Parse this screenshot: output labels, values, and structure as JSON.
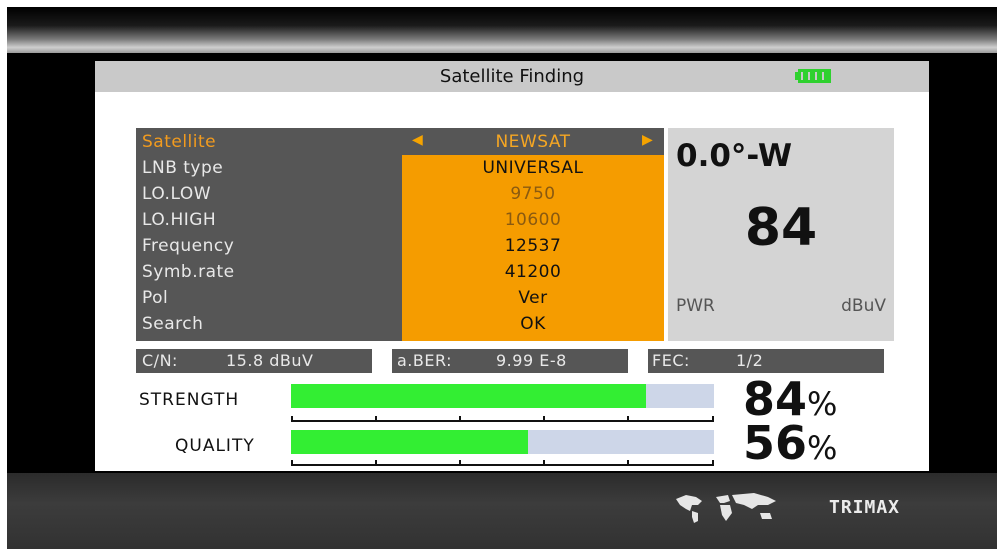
{
  "title": "Satellite Finding",
  "battery": {
    "level": "full",
    "color": "#2fd12f"
  },
  "settings": {
    "rows": [
      {
        "label": "Satellite",
        "value": "NEWSAT"
      },
      {
        "label": "LNB type",
        "value": "UNIVERSAL"
      },
      {
        "label": "LO.LOW",
        "value": "9750"
      },
      {
        "label": "LO.HIGH",
        "value": "10600"
      },
      {
        "label": "Frequency",
        "value": "12537"
      },
      {
        "label": "Symb.rate",
        "value": "41200"
      },
      {
        "label": "Pol",
        "value": "Ver"
      },
      {
        "label": "Search",
        "value": "OK"
      }
    ]
  },
  "readout": {
    "orbit": "0.0°-W",
    "level": "84",
    "label": "PWR",
    "unit": "dBuV"
  },
  "stats": {
    "cn_label": "C/N:",
    "cn_value": "15.8 dBuV",
    "ber_label": "a.BER:",
    "ber_value": "9.99 E-8",
    "fec_label": "FEC:",
    "fec_value": "1/2"
  },
  "meters": {
    "strength": {
      "label": "STRENGTH",
      "percent_value": 84,
      "number": "84",
      "unit": "%"
    },
    "quality": {
      "label": "QUALITY",
      "percent_value": 56,
      "number": "56",
      "unit": "%"
    }
  },
  "colors": {
    "accent": "#f59c00",
    "bar_fill": "#33ee33",
    "bar_track": "#cdd6e8"
  },
  "footer": {
    "brand": "TRIMAX",
    "logo_icon": "world-map-icon"
  }
}
